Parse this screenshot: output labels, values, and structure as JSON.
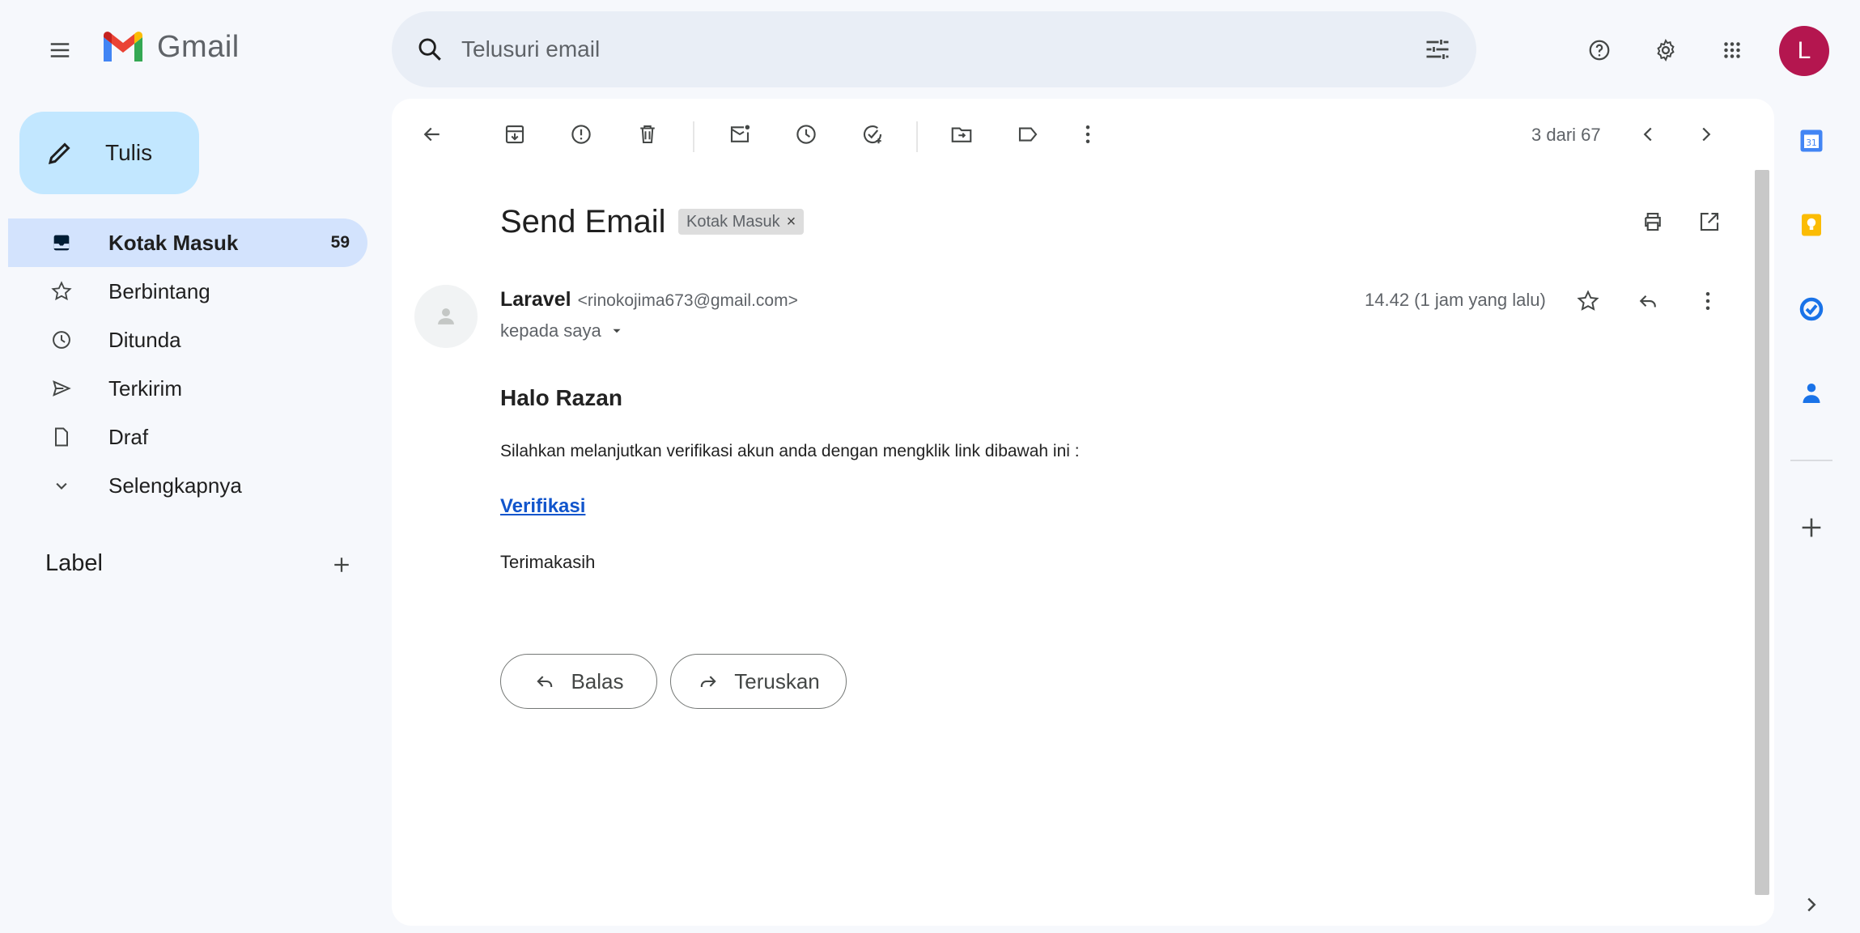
{
  "header": {
    "app_name": "Gmail",
    "search_placeholder": "Telusuri email",
    "avatar_initial": "L"
  },
  "compose": {
    "label": "Tulis"
  },
  "sidebar": {
    "items": [
      {
        "label": "Kotak Masuk",
        "count": "59",
        "icon": "inbox-icon"
      },
      {
        "label": "Berbintang",
        "count": "",
        "icon": "star-icon"
      },
      {
        "label": "Ditunda",
        "count": "",
        "icon": "clock-icon"
      },
      {
        "label": "Terkirim",
        "count": "",
        "icon": "send-icon"
      },
      {
        "label": "Draf",
        "count": "",
        "icon": "draft-icon"
      },
      {
        "label": "Selengkapnya",
        "count": "",
        "icon": "chevron-down-icon"
      }
    ],
    "label_heading": "Label"
  },
  "toolbar": {
    "pager": "3 dari 67"
  },
  "email": {
    "subject": "Send Email",
    "label_chip": "Kotak Masuk",
    "label_chip_close": "×",
    "sender_name": "Laravel",
    "sender_email": "<rinokojima673@gmail.com>",
    "recipient": "kepada saya",
    "timestamp": "14.42 (1 jam yang lalu)",
    "greeting": "Halo Razan",
    "body": "Silahkan melanjutkan verifikasi akun anda dengan mengklik link dibawah ini :",
    "link_text": "Verifikasi",
    "closing": "Terimakasih"
  },
  "actions": {
    "reply_label": "Balas",
    "forward_label": "Teruskan"
  },
  "colors": {
    "accent_blue": "#0b57d0",
    "compose_bg": "#c2e7ff",
    "active_nav_bg": "#d3e3fd",
    "avatar_bg": "#b4164f",
    "link": "#1155cc"
  }
}
